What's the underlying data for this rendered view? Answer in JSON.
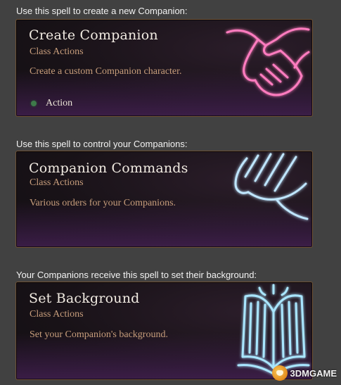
{
  "sections": [
    {
      "caption": "Use this spell to create a new Companion:",
      "title": "Create Companion",
      "subtitle": "Class Actions",
      "description": "Create a custom Companion character.",
      "action_label": "Action",
      "art_icon": "handshake-icon",
      "art_color": "#ff7bbf"
    },
    {
      "caption": "Use this spell to control your Companions:",
      "title": "Companion Commands",
      "subtitle": "Class Actions",
      "description": "Various orders for your Companions.",
      "art_icon": "commanding-hand-icon",
      "art_color": "#bfe6ff"
    },
    {
      "caption": "Your Companions receive this spell to set their background:",
      "title": "Set Background",
      "subtitle": "Class Actions",
      "description": "Set your Companion's background.",
      "art_icon": "open-book-icon",
      "art_color": "#a9e6ff"
    }
  ],
  "watermark": {
    "text": "3DMGAME",
    "icon": "3dm-logo-icon"
  },
  "colors": {
    "background": "#414141",
    "card_border": "#6e5135",
    "title_text": "#f1ebe2",
    "secondary_text": "#c89e7c",
    "action_dot": "#3e7a4a"
  }
}
